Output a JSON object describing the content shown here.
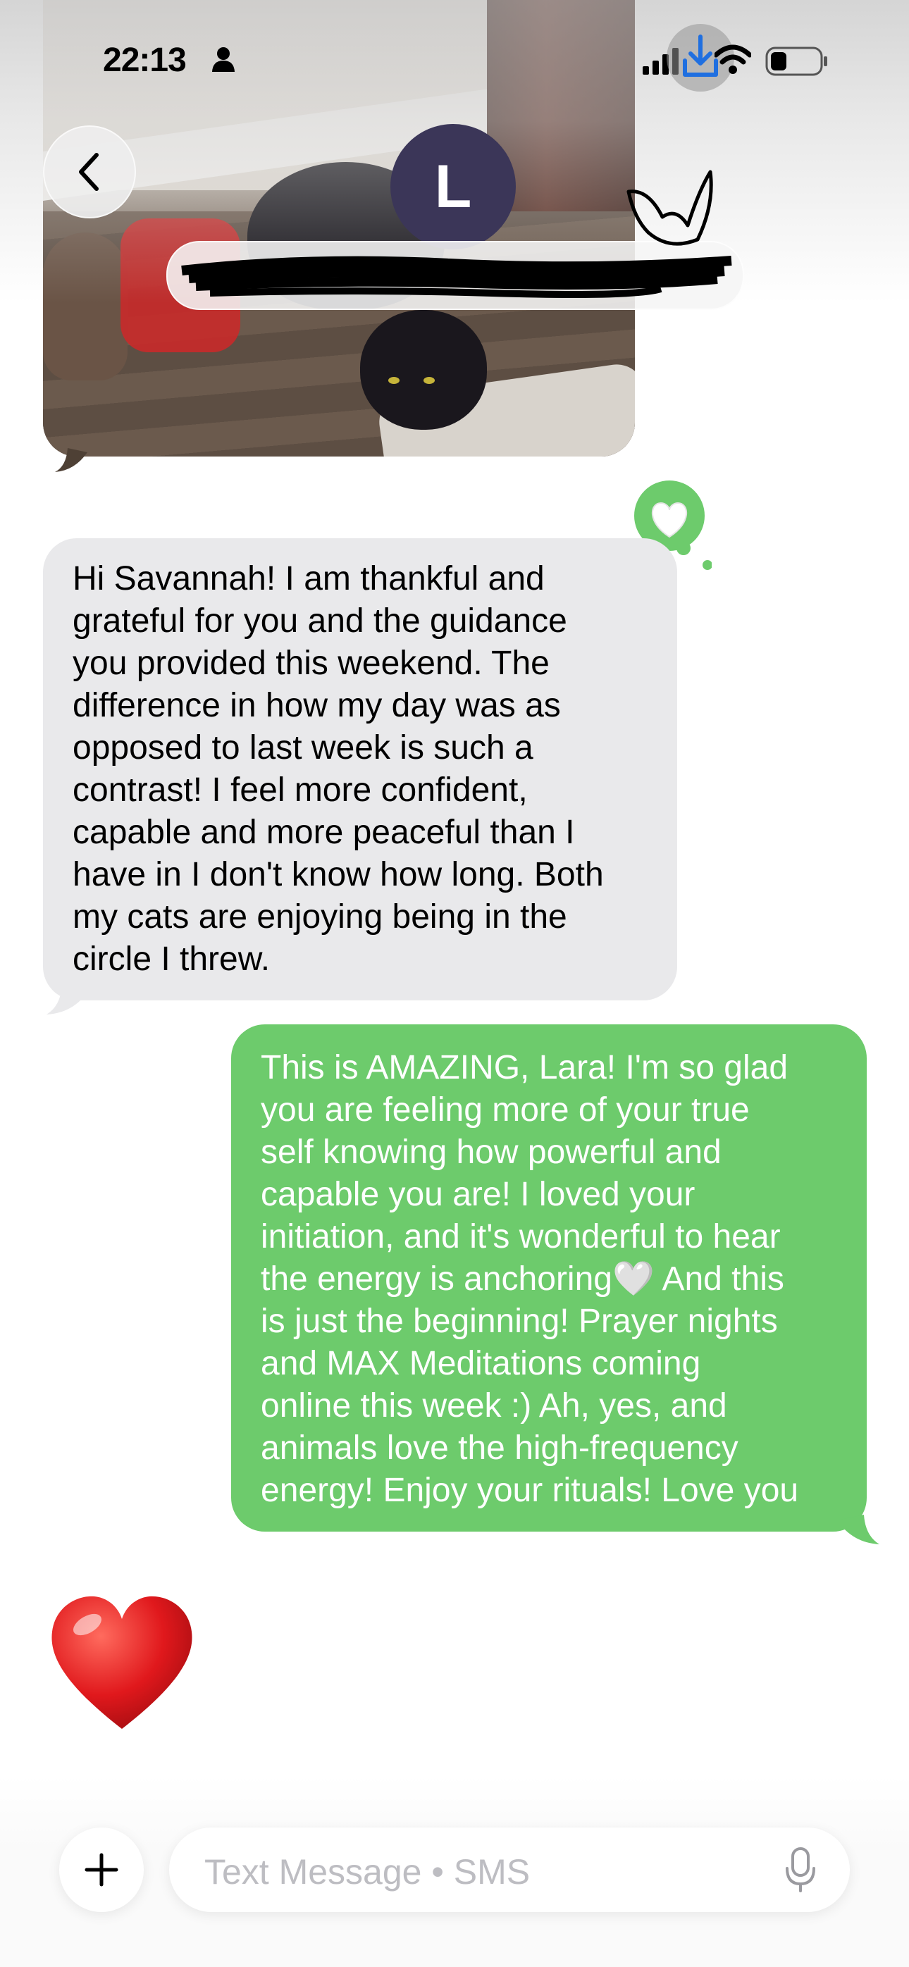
{
  "status_bar": {
    "time": "22:13",
    "icons": [
      "person-icon",
      "signal-icon",
      "download-icon",
      "wifi-icon",
      "battery-icon"
    ]
  },
  "header": {
    "avatar_initial": "L",
    "contact_name_redacted": true
  },
  "messages": [
    {
      "type": "image",
      "direction": "incoming",
      "content": "photo of a black cat on a wooden floor"
    },
    {
      "type": "text",
      "direction": "incoming",
      "tapback": "white-heart",
      "lines": [
        "Hi Savannah! I am thankful and",
        "grateful for you and the guidance",
        "you provided this weekend. The",
        "difference in how my day was as",
        "opposed to last week is such a",
        "contrast! I feel more confident,",
        "capable and more peaceful than I",
        "have in I don't know how long. Both",
        "my cats are enjoying being in the",
        "circle I threw."
      ]
    },
    {
      "type": "text",
      "direction": "outgoing",
      "lines": [
        "This is AMAZING, Lara! I'm so glad",
        "you are feeling more of your true",
        "self knowing how powerful and",
        "capable you are! I loved your",
        "initiation, and it's wonderful to hear",
        "the energy is anchoring🤍 And this",
        "is just the beginning! Prayer nights",
        "and MAX Meditations coming",
        "online this week :) Ah, yes, and",
        "animals love the high-frequency",
        "energy! Enjoy your rituals! Love you"
      ]
    },
    {
      "type": "emoji",
      "direction": "incoming",
      "emoji": "❤️"
    }
  ],
  "composer": {
    "placeholder": "Text Message • SMS",
    "plus_icon": "plus-icon",
    "mic_icon": "mic-icon"
  },
  "colors": {
    "incoming_bubble": "#e9e9eb",
    "outgoing_bubble": "#6dcb6c",
    "avatar": "#3b3658"
  }
}
